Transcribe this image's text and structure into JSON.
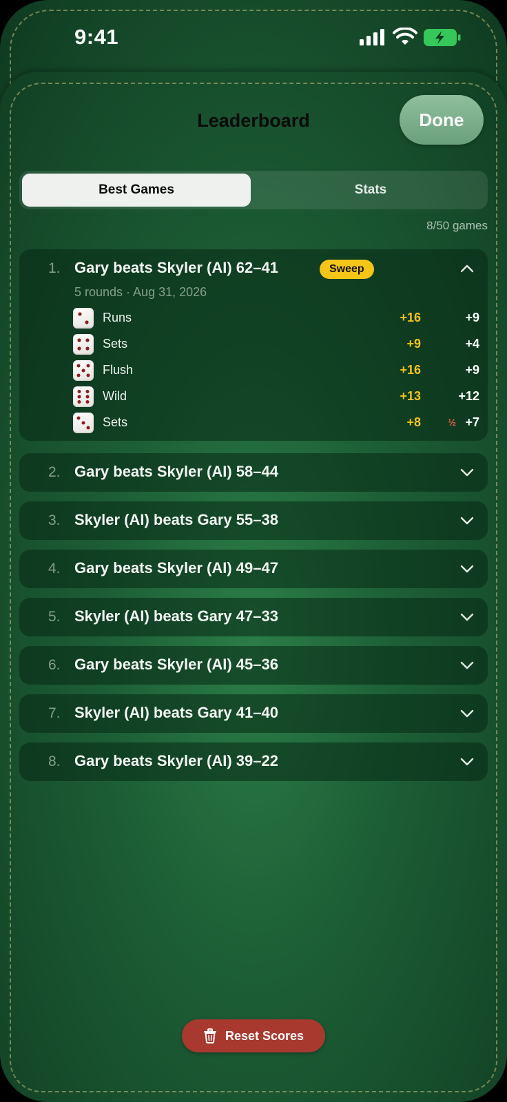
{
  "status_bar": {
    "time": "9:41",
    "signal_icon": "cellular-signal-icon",
    "wifi_icon": "wifi-icon",
    "battery_icon": "battery-charging-icon"
  },
  "header": {
    "title": "Leaderboard",
    "done_label": "Done"
  },
  "tabs": {
    "active": "Best Games",
    "inactive": "Stats"
  },
  "games_count": "8/50 games",
  "games": [
    {
      "rank": "1.",
      "title": "Gary beats Skyler (AI) 62–41",
      "badge": "Sweep",
      "meta": "5 rounds · Aug 31, 2026",
      "rounds": [
        {
          "pips": 2,
          "label": "Runs",
          "score1": "+16",
          "score2": "+9",
          "note": ""
        },
        {
          "pips": 4,
          "label": "Sets",
          "score1": "+9",
          "score2": "+4",
          "note": ""
        },
        {
          "pips": 5,
          "label": "Flush",
          "score1": "+16",
          "score2": "+9",
          "note": ""
        },
        {
          "pips": 6,
          "label": "Wild",
          "score1": "+13",
          "score2": "+12",
          "note": ""
        },
        {
          "pips": 3,
          "label": "Sets",
          "score1": "+8",
          "score2": "+7",
          "note": "½"
        }
      ]
    },
    {
      "rank": "2.",
      "title": "Gary beats Skyler (AI) 58–44"
    },
    {
      "rank": "3.",
      "title": "Skyler (AI) beats Gary 55–38"
    },
    {
      "rank": "4.",
      "title": "Gary beats Skyler (AI) 49–47"
    },
    {
      "rank": "5.",
      "title": "Skyler (AI) beats Gary 47–33"
    },
    {
      "rank": "6.",
      "title": "Gary beats Skyler (AI) 45–36"
    },
    {
      "rank": "7.",
      "title": "Skyler (AI) beats Gary 41–40"
    },
    {
      "rank": "8.",
      "title": "Gary beats Skyler (AI) 39–22"
    }
  ],
  "reset_label": "Reset Scores",
  "colors": {
    "felt": "#1d5f36",
    "accent_yellow": "#f2c21a",
    "reset_red": "#a8392f",
    "badge_yellow": "#f5c518"
  }
}
